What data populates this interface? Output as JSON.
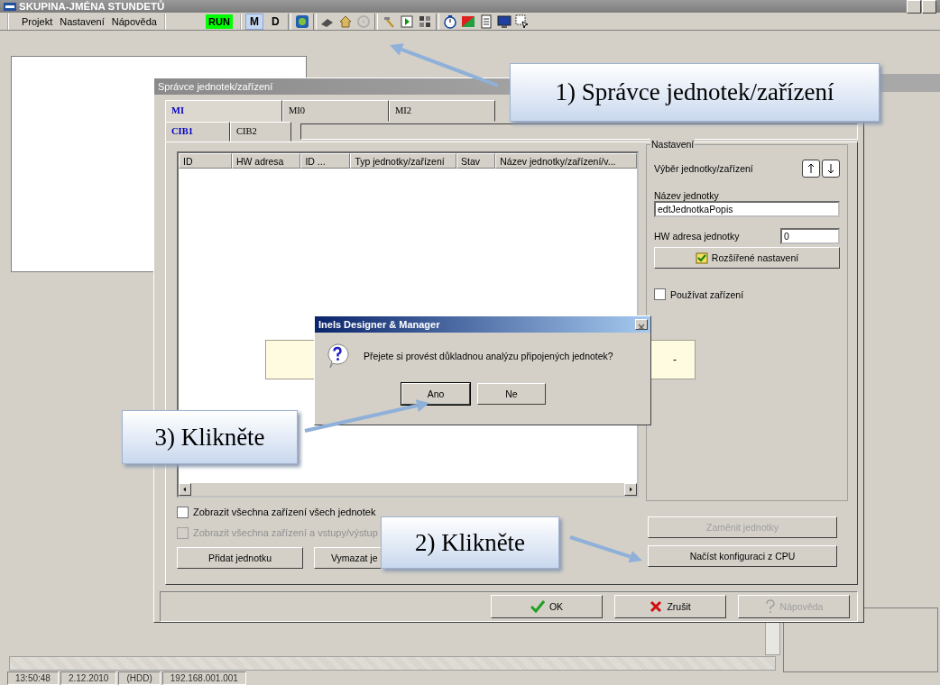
{
  "window": {
    "title": "SKUPINA-JMÉNA STUNDETŮ"
  },
  "menu": [
    "Projekt",
    "Nastavení",
    "Nápověda"
  ],
  "toolbar": {
    "run": "RUN",
    "modes": [
      {
        "label": "M",
        "selected": true
      },
      {
        "label": "D",
        "selected": false
      }
    ]
  },
  "dialog": {
    "title": "Správce jednotek/zařízení",
    "tabs": [
      {
        "label": "MI",
        "selected": true
      },
      {
        "label": "MI0",
        "selected": false
      },
      {
        "label": "MI2",
        "selected": false
      }
    ],
    "subtabs": [
      {
        "label": "CIB1",
        "selected": true
      },
      {
        "label": "CIB2",
        "selected": false
      }
    ],
    "table": {
      "columns": [
        "ID",
        "HW adresa",
        "ID ...",
        "Typ jednotky/zařízení",
        "Stav",
        "Název jednotky/zařízení/v..."
      ]
    },
    "settings": {
      "title": "Nastavení",
      "select_label": "Výběr jednotky/zařízení",
      "name_label": "Název jednotky",
      "name_value": "edtJednotkaPopis",
      "hw_label": "HW adresa jednotky",
      "hw_value": "0",
      "advanced_button": "Rozšířené nastavení",
      "use_device": {
        "label": "Používat zařízení",
        "checked": false
      }
    },
    "info_panel": {
      "text": "-"
    },
    "checkboxes": [
      {
        "label": "Zobrazit všechna zařízení všech jednotek",
        "checked": false,
        "disabled": false
      },
      {
        "label": "Zobrazit všechna zařízení a vstupy/výstup",
        "checked": false,
        "disabled": true
      }
    ],
    "buttons": [
      {
        "label": "Přidat jednotku"
      },
      {
        "label": "Vymazat je"
      }
    ],
    "side_buttons": [
      {
        "label": "Zaměnit jednotky",
        "disabled": true
      },
      {
        "label": "Načíst konfiguraci z CPU",
        "disabled": false
      }
    ],
    "footer_buttons": [
      {
        "kind": "ok",
        "label": "OK",
        "disabled": false
      },
      {
        "kind": "cancel",
        "label": "Zrušit",
        "disabled": false
      },
      {
        "kind": "help",
        "label": "Nápověda",
        "disabled": true
      }
    ]
  },
  "message_box": {
    "title": "Inels Designer & Manager",
    "text": "Přejete si provést důkladnou analýzu připojených jednotek?",
    "buttons": [
      {
        "label": "Ano",
        "selected": true
      },
      {
        "label": "Ne",
        "selected": false
      }
    ]
  },
  "annotations": [
    "1) Správce jednotek/zařízení",
    "3) Klikněte",
    "2) Klikněte"
  ],
  "status_bar": [
    "13:50:48",
    "2.12.2010",
    "(HDD)",
    "192.168.001.001"
  ]
}
